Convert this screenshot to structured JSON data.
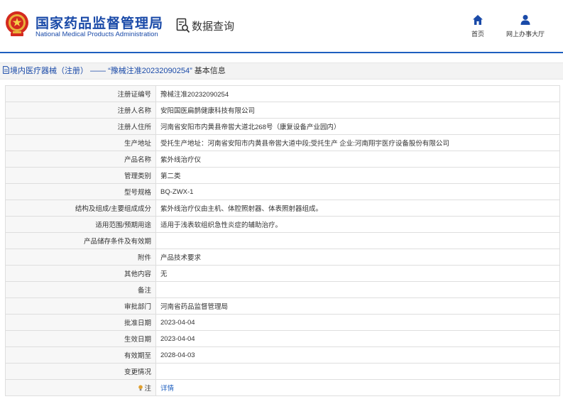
{
  "header": {
    "org_name_cn": "国家药品监督管理局",
    "org_name_en": "National Medical Products Administration",
    "query_label": "数据查询",
    "nav": {
      "home": "首页",
      "online_office": "网上办事大厅"
    },
    "accent_color": "#1e5fbf"
  },
  "title_bar": {
    "prefix": "境内医疗器械（注册） —— ",
    "reg_no": "“豫械注准20232090254”",
    "suffix": " 基本信息"
  },
  "rows": [
    {
      "label": "注册证编号",
      "value": "豫械注准20232090254"
    },
    {
      "label": "注册人名称",
      "value": "安阳国医扁鹊健康科技有限公司"
    },
    {
      "label": "注册人住所",
      "value": "河南省安阳市内黄县帝喾大道北268号（康复设备产业园内）"
    },
    {
      "label": "生产地址",
      "value": "受托生产地址：河南省安阳市内黄县帝喾大道中段;受托生产 企业:河南翔宇医疗设备股份有限公司"
    },
    {
      "label": "产品名称",
      "value": "紫外线治疗仪"
    },
    {
      "label": "管理类别",
      "value": "第二类"
    },
    {
      "label": "型号规格",
      "value": "BQ-ZWX-1"
    },
    {
      "label": "结构及组成/主要组成成分",
      "value": "紫外线治疗仪由主机、体腔照射器、体表照射器组成。"
    },
    {
      "label": "适用范围/预期用途",
      "value": "适用于浅表软组织急性炎症的辅助治疗。"
    },
    {
      "label": "产品储存条件及有效期",
      "value": ""
    },
    {
      "label": "附件",
      "value": "产品技术要求"
    },
    {
      "label": "其他内容",
      "value": "无"
    },
    {
      "label": "备注",
      "value": ""
    },
    {
      "label": "审批部门",
      "value": "河南省药品监督管理局"
    },
    {
      "label": "批准日期",
      "value": "2023-04-04"
    },
    {
      "label": "生效日期",
      "value": "2023-04-04"
    },
    {
      "label": "有效期至",
      "value": "2028-04-03"
    },
    {
      "label": "变更情况",
      "value": ""
    },
    {
      "label": "注",
      "value": "详情"
    }
  ]
}
